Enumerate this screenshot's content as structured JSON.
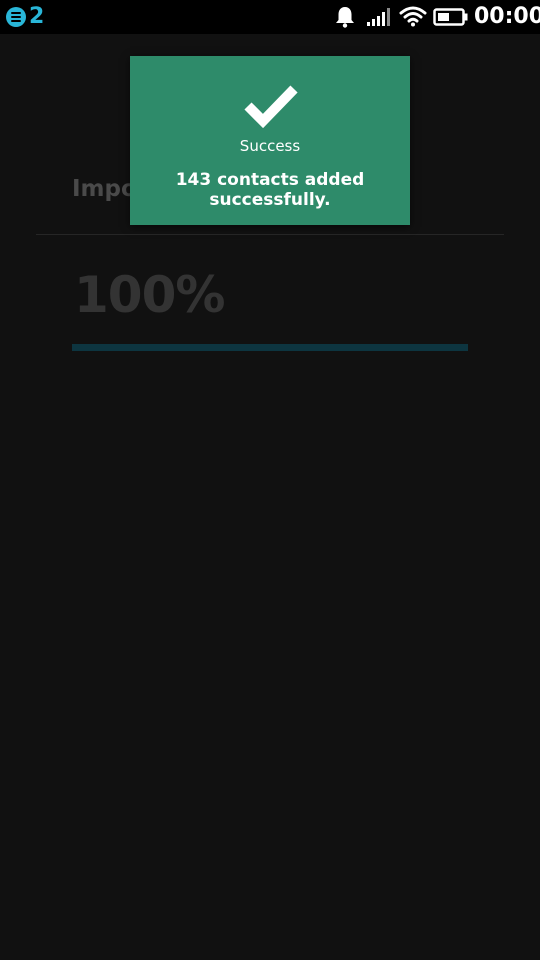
{
  "status_bar": {
    "notification_count": "2",
    "time": "00:00",
    "icons": [
      "notifications-icon",
      "bell-icon",
      "signal-icon",
      "wifi-icon",
      "battery-icon"
    ]
  },
  "background": {
    "title": "Impo",
    "progress_text": "100%",
    "progress_value": 1.0
  },
  "toast": {
    "icon": "checkmark-icon",
    "title": "Success",
    "message": "143 contacts added successfully."
  },
  "colors": {
    "toast_bg": "#2e8b6a",
    "accent": "#29b6d8",
    "page_bg": "#111111",
    "progress_bar": "#0d3540"
  }
}
